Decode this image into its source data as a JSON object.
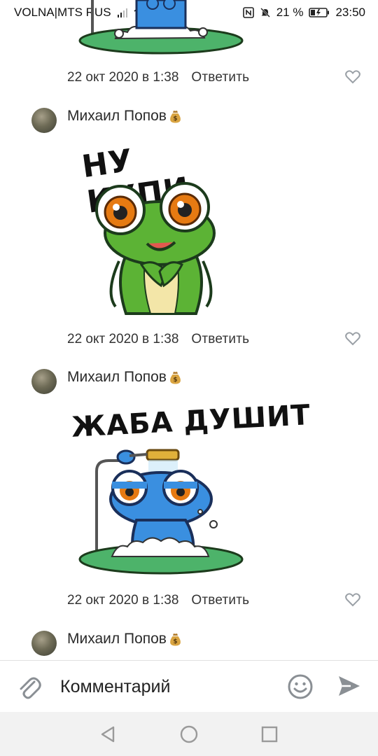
{
  "status_bar": {
    "carrier": "VOLNA|MTS RUS",
    "battery_percent": "21 %",
    "time": "23:50",
    "icons": [
      "signal-icon",
      "wifi-icon",
      "search-icon",
      "nfc-icon",
      "mute-icon",
      "battery-icon"
    ]
  },
  "comments": [
    {
      "partial": true,
      "sticker": "frog-shower-sticker-bottom",
      "date": "22 окт 2020 в 1:38",
      "reply_label": "Ответить"
    },
    {
      "author": "Михаил Попов",
      "author_badge": "money-bag-icon",
      "sticker_caption": "НУ КУПИ",
      "sticker": "green-frog-please-sticker",
      "date": "22 окт 2020 в 1:38",
      "reply_label": "Ответить"
    },
    {
      "author": "Михаил Попов",
      "author_badge": "money-bag-icon",
      "sticker_caption": "ЖАБА ДУШИТ",
      "sticker": "blue-frog-shower-sticker",
      "date": "22 окт 2020 в 1:38",
      "reply_label": "Ответить"
    },
    {
      "author": "Михаил Попов",
      "author_badge": "money-bag-icon"
    }
  ],
  "comment_bar": {
    "placeholder": "Комментарий",
    "attach_icon": "paperclip-icon",
    "emoji_icon": "smile-icon",
    "send_icon": "send-icon"
  },
  "nav_bar": {
    "icons": [
      "back-icon",
      "home-icon",
      "recents-icon"
    ]
  },
  "colors": {
    "frog_green": "#5cb335",
    "frog_blue": "#3a8fe0",
    "eye_orange": "#e67a12",
    "puddle_green": "#4db36a",
    "icon_grey": "#9aa0a6"
  }
}
